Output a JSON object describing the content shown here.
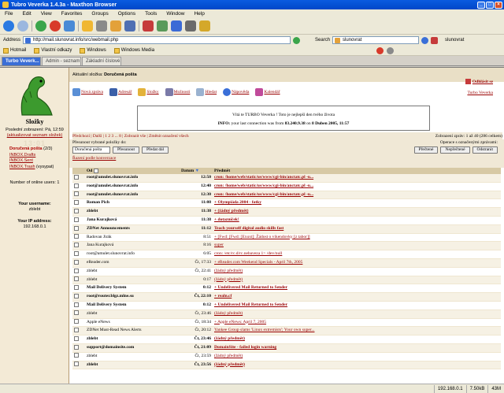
{
  "window": {
    "title": "Tubro Veverka 1.4.3a - Maxthon Browser"
  },
  "menu": [
    "File",
    "Edit",
    "View",
    "Favorites",
    "Groups",
    "Options",
    "Tools",
    "Window",
    "Help"
  ],
  "address": {
    "label": "Address",
    "url": "http://mail.slunovrat.info/src/webmail.php"
  },
  "search": {
    "label": "Search",
    "value": "slunovrat",
    "side_value": "slunovrat"
  },
  "links": [
    "Hotmail",
    "Vlastní odkazy",
    "Windows",
    "Windows Media"
  ],
  "tabs": [
    "Turbo Veverk...",
    "Admin - seznam (6...",
    "Základní číslové..."
  ],
  "sidebar": {
    "title": "Složky",
    "last_update_line1": "Poslední zobrazení: Pá, 12:59",
    "refresh_link": "(aktualizovat seznam složek)",
    "folders": [
      {
        "name": "Doručená pošta",
        "count": "(2/3)",
        "style": "red"
      },
      {
        "name": "INBOX.Drafts",
        "count": "",
        "style": "lnk"
      },
      {
        "name": "INBOX.Sent",
        "count": "",
        "style": "lnk"
      },
      {
        "name": "INBOX.Trash",
        "count": "(vysypat)",
        "style": "lnk"
      }
    ],
    "online_users": "Number of online users: 1",
    "username_label": "Your username:",
    "username": "zblebt",
    "ip_label": "Your IP address:",
    "ip": "192.168.0.1"
  },
  "main": {
    "current_folder_label": "Aktuální složka:",
    "current_folder": "Doručená pošta",
    "logout": "Odhlásit se",
    "brand_link": "Turbo Veverka",
    "nav": [
      "Nová zpráva",
      "Adresář",
      "Složky",
      "Možnosti",
      "Hledat",
      "Nápověda",
      "Kalendář"
    ],
    "welcome": "Vítá te TURBO Veverka ! Toto je nejlepší den tvého života",
    "info_label": "INFO:",
    "info_text": "your last connection was from",
    "info_ip": "83.240.9.38",
    "info_on": "on",
    "info_date": "8 Duben 2005, 11:57",
    "pager_text": "Předchozí | Další | 1 2 3 ... 8 | Zobrazit vše | Změnit označení všech",
    "pager_count": "Zobrazení zpráv: 1 až 40 (286 celkem)",
    "move_label": "Přesunout vybrané položky do:",
    "move_select": "Doručená pošta",
    "move_btn": "Přesunout",
    "forward_btn": "Předat dál",
    "rules_link": "Řazení podle konverzace",
    "ops_label": "Operace s označenými zprávami:",
    "read_btn": "Přečtené",
    "unread_btn": "Nepřečtené",
    "delete_btn": "Odstranit",
    "col_from": "Od",
    "col_date": "Datum",
    "col_subject": "Předmět"
  },
  "messages": [
    {
      "from": "root@amulet.slunovrat.info",
      "date": "12:50",
      "subject": "cron: /home/web/static/us/www/cgi-bin/anctatc.pl -u...",
      "unread": true
    },
    {
      "from": "root@amulet.slunovrat.info",
      "date": "12:40",
      "subject": "cron: /home/web/static/us/www/cgi-bin/anctatc.pl -u...",
      "unread": true
    },
    {
      "from": "root@amulet.slunovrat.info",
      "date": "12:30",
      "subject": "cron: /home/web/static/us/www/cgi-bin/anctatc.pl -u...",
      "unread": true
    },
    {
      "from": "Roman Pich",
      "date": "11:08",
      "subject": "+ Olympiáda 2004 - fotky",
      "unread": true
    },
    {
      "from": "zblebt",
      "date": "11:38",
      "subject": "+ (žádný předmět)",
      "unread": true
    },
    {
      "from": "Jana Kurajková",
      "date": "11:38",
      "subject": "+ dotazníček!",
      "unread": true
    },
    {
      "from": "ZDNet Announcements",
      "date": "11:12",
      "subject": "Teach yourself digital audio skills fast",
      "unread": true
    },
    {
      "from": "Radovan Jirák",
      "date": "8:51",
      "subject": "+ [Fwd: [Fwd: [Exuxt]: Žádost o vikendovky [z tabor]]",
      "unread": false
    },
    {
      "from": "Jana Kurajková",
      "date": "8:16",
      "subject": "super",
      "unread": false
    },
    {
      "from": "root@amulet.slunovrat.info",
      "date": "6:05",
      "subject": "cron: /etc/rc.d/rc.nebaveza 1> /dev/null",
      "unread": false
    },
    {
      "from": "eReader.com",
      "date": "Čt, 17:33",
      "subject": "+ eReader.com Weekend Specials - April 7th, 2005",
      "unread": false
    },
    {
      "from": "zblebt",
      "date": "Čt, 22:41",
      "subject": "(žádný předmět)",
      "unread": false
    },
    {
      "from": "zblebt",
      "date": "0:17",
      "subject": "(žádný předmět)",
      "unread": false
    },
    {
      "from": "Mail Delivery System",
      "date": "0:12",
      "subject": "+ Undelivered Mail Returned to Sender",
      "unread": true
    },
    {
      "from": "root@router.blgz.mlne.su",
      "date": "Čt, 22:10",
      "subject": "+ realn.cf",
      "unread": true
    },
    {
      "from": "Mail Delivery System",
      "date": "0:12",
      "subject": "+ Undelivered Mail Returned to Sender",
      "unread": true
    },
    {
      "from": "zblebt",
      "date": "Čt, 23:46",
      "subject": "(žádný předmět)",
      "unread": false
    },
    {
      "from": "Apple eNews",
      "date": "Čt, 18:34",
      "subject": "+ Apple eNews: April 7, 2005",
      "unread": false
    },
    {
      "from": "ZDNet Must-Read News Alerts",
      "date": "Čt, 20:12",
      "subject": "Yankee Group slams 'Linux extremists'; Your own super...",
      "unread": false
    },
    {
      "from": "zblebt",
      "date": "Čt, 23:46",
      "subject": "(žádný předmět)",
      "unread": true
    },
    {
      "from": "support@domainsite.com",
      "date": "Čt, 21:09",
      "subject": "DomainSite - failed login warning",
      "unread": true
    },
    {
      "from": "zblebt",
      "date": "Čt, 23:59",
      "subject": "(žádný předmět)",
      "unread": false
    },
    {
      "from": "zblebt",
      "date": "Čt, 23:56",
      "subject": "(žádný předmět)",
      "unread": true
    }
  ],
  "status": {
    "ip": "192.168.0.1",
    "speed": "7.50kB",
    "size": "43M"
  }
}
